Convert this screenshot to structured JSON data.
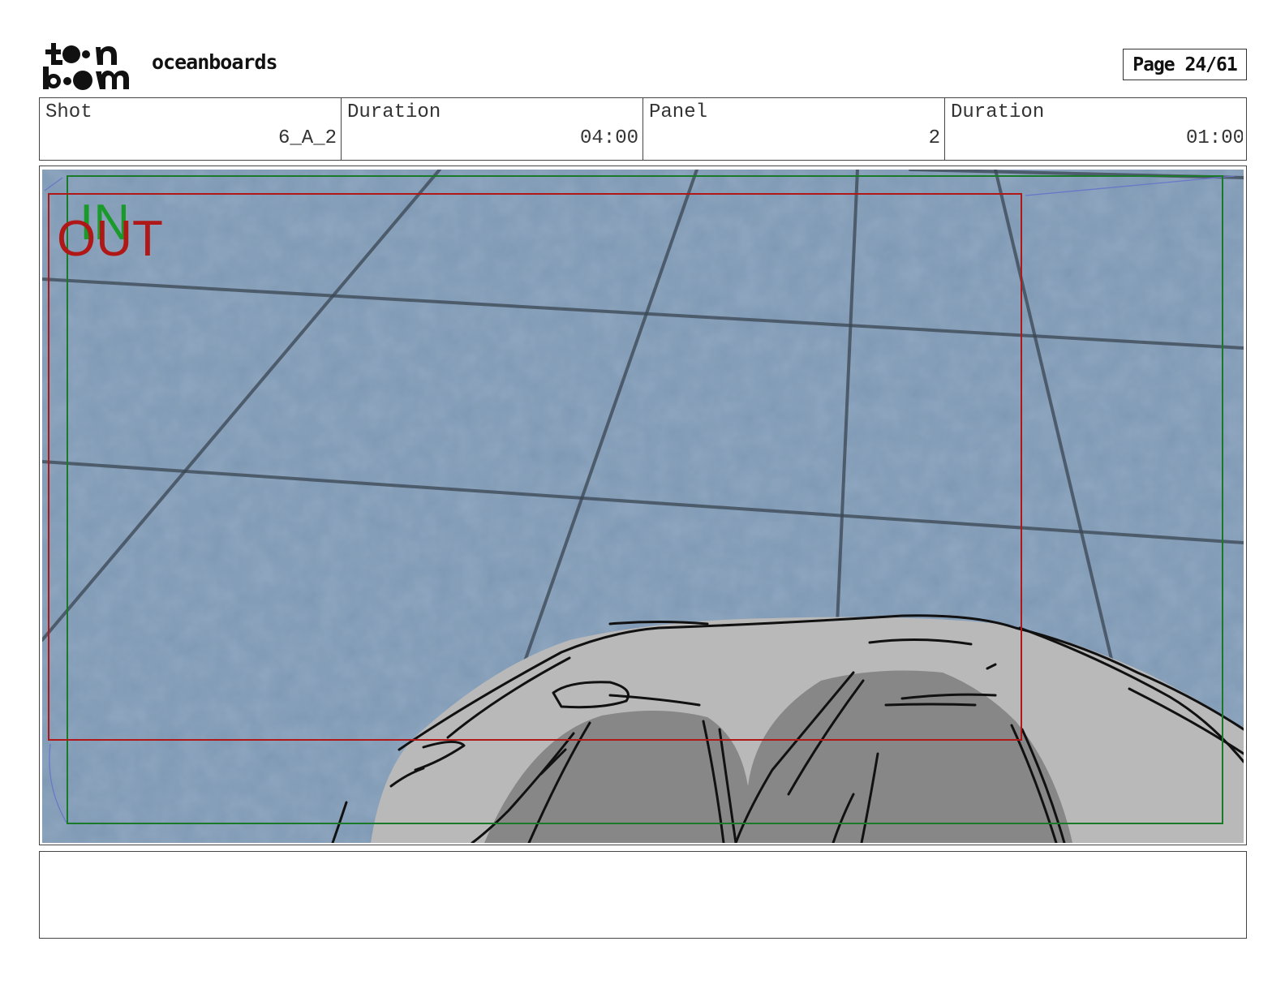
{
  "header": {
    "logo_text_top": "toon",
    "logo_text_bottom": "boom",
    "project_name": "oceanboards",
    "page_label": "Page 24/61"
  },
  "info": {
    "shot_label": "Shot",
    "shot_value": "6_A_2",
    "shot_duration_label": "Duration",
    "shot_duration_value": "04:00",
    "panel_label": "Panel",
    "panel_value": "2",
    "panel_duration_label": "Duration",
    "panel_duration_value": "01:00"
  },
  "panel": {
    "in_label": "IN",
    "out_label": "OUT",
    "in_color": "#1a9a2a",
    "out_color": "#b01818",
    "water_color": "#7d97b3",
    "grid_line_color": "#3a4652",
    "rock_light_color": "#b9b9b9",
    "rock_dark_color": "#878787"
  },
  "caption": {
    "text": ""
  }
}
